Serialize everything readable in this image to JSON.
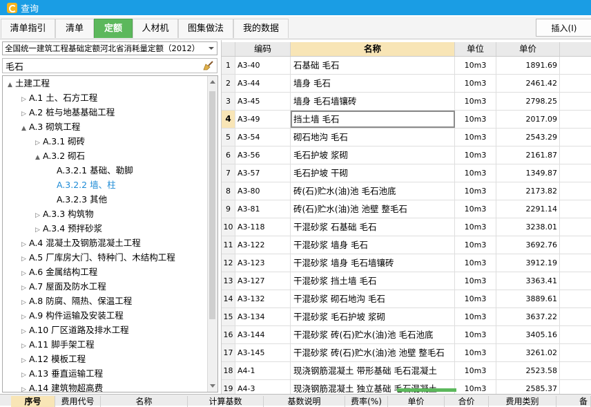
{
  "window": {
    "title": "查询"
  },
  "tabs": [
    {
      "label": "清单指引",
      "active": false
    },
    {
      "label": "清单",
      "active": false
    },
    {
      "label": "定额",
      "active": true
    },
    {
      "label": "人材机",
      "active": false
    },
    {
      "label": "图集做法",
      "active": false
    },
    {
      "label": "我的数据",
      "active": false
    }
  ],
  "insert_button": "插入(I)",
  "quota_select": {
    "value": "全国统一建筑工程基础定额河北省消耗量定额（2012）"
  },
  "search": {
    "value": "毛石",
    "icon": "broom-icon"
  },
  "tree": [
    {
      "label": "土建工程",
      "level": 0,
      "toggle": "▲"
    },
    {
      "label": "A.1 土、石方工程",
      "level": 1,
      "toggle": "▷"
    },
    {
      "label": "A.2 桩与地基基础工程",
      "level": 1,
      "toggle": "▷"
    },
    {
      "label": "A.3 砌筑工程",
      "level": 1,
      "toggle": "▲"
    },
    {
      "label": "A.3.1 砌砖",
      "level": 2,
      "toggle": "▷"
    },
    {
      "label": "A.3.2 砌石",
      "level": 2,
      "toggle": "▲"
    },
    {
      "label": "A.3.2.1 基础、勒脚",
      "level": 3,
      "toggle": ""
    },
    {
      "label": "A.3.2.2 墙、柱",
      "level": 3,
      "toggle": "",
      "selected": true
    },
    {
      "label": "A.3.2.3 其他",
      "level": 3,
      "toggle": ""
    },
    {
      "label": "A.3.3 构筑物",
      "level": 2,
      "toggle": "▷"
    },
    {
      "label": "A.3.4 预拌砂浆",
      "level": 2,
      "toggle": "▷"
    },
    {
      "label": "A.4 混凝土及钢筋混凝土工程",
      "level": 1,
      "toggle": "▷"
    },
    {
      "label": "A.5 厂库房大门、特种门、木结构工程",
      "level": 1,
      "toggle": "▷"
    },
    {
      "label": "A.6 金属结构工程",
      "level": 1,
      "toggle": "▷"
    },
    {
      "label": "A.7 屋面及防水工程",
      "level": 1,
      "toggle": "▷"
    },
    {
      "label": "A.8 防腐、隔热、保温工程",
      "level": 1,
      "toggle": "▷"
    },
    {
      "label": "A.9 构件运输及安装工程",
      "level": 1,
      "toggle": "▷"
    },
    {
      "label": "A.10 厂区道路及排水工程",
      "level": 1,
      "toggle": "▷"
    },
    {
      "label": "A.11 脚手架工程",
      "level": 1,
      "toggle": "▷"
    },
    {
      "label": "A.12 模板工程",
      "level": 1,
      "toggle": "▷"
    },
    {
      "label": "A.13 垂直运输工程",
      "level": 1,
      "toggle": "▷"
    },
    {
      "label": "A.14 建筑物超高费",
      "level": 1,
      "toggle": "▷"
    }
  ],
  "table": {
    "headers": [
      "编码",
      "名称",
      "单位",
      "单价"
    ],
    "rows": [
      {
        "idx": "1",
        "code": "A3-40",
        "name": "石基础 毛石",
        "unit": "10m3",
        "price": "1891.69"
      },
      {
        "idx": "2",
        "code": "A3-44",
        "name": "墙身 毛石",
        "unit": "10m3",
        "price": "2461.42"
      },
      {
        "idx": "3",
        "code": "A3-45",
        "name": "墙身 毛石墙镶砖",
        "unit": "10m3",
        "price": "2798.25"
      },
      {
        "idx": "4",
        "code": "A3-49",
        "name": "挡土墙 毛石",
        "unit": "10m3",
        "price": "2017.09",
        "active": true
      },
      {
        "idx": "5",
        "code": "A3-54",
        "name": "砌石地沟 毛石",
        "unit": "10m3",
        "price": "2543.29"
      },
      {
        "idx": "6",
        "code": "A3-56",
        "name": "毛石护坡 浆砌",
        "unit": "10m3",
        "price": "2161.87"
      },
      {
        "idx": "7",
        "code": "A3-57",
        "name": "毛石护坡 干砌",
        "unit": "10m3",
        "price": "1349.87"
      },
      {
        "idx": "8",
        "code": "A3-80",
        "name": "砖(石)贮水(油)池 毛石池底",
        "unit": "10m3",
        "price": "2173.82"
      },
      {
        "idx": "9",
        "code": "A3-81",
        "name": "砖(石)贮水(油)池 池壁 整毛石",
        "unit": "10m3",
        "price": "2291.14"
      },
      {
        "idx": "10",
        "code": "A3-118",
        "name": "干混砂浆 石基础 毛石",
        "unit": "10m3",
        "price": "3238.01"
      },
      {
        "idx": "11",
        "code": "A3-122",
        "name": "干混砂浆 墙身 毛石",
        "unit": "10m3",
        "price": "3692.76"
      },
      {
        "idx": "12",
        "code": "A3-123",
        "name": "干混砂浆 墙身 毛石墙镶砖",
        "unit": "10m3",
        "price": "3912.19"
      },
      {
        "idx": "13",
        "code": "A3-127",
        "name": "干混砂浆 挡土墙 毛石",
        "unit": "10m3",
        "price": "3363.41"
      },
      {
        "idx": "14",
        "code": "A3-132",
        "name": "干混砂浆 砌石地沟 毛石",
        "unit": "10m3",
        "price": "3889.61"
      },
      {
        "idx": "15",
        "code": "A3-134",
        "name": "干混砂浆 毛石护坡 浆砌",
        "unit": "10m3",
        "price": "3637.22"
      },
      {
        "idx": "16",
        "code": "A3-144",
        "name": "干混砂浆 砖(石)贮水(油)池 毛石池底",
        "unit": "10m3",
        "price": "3405.16"
      },
      {
        "idx": "17",
        "code": "A3-145",
        "name": "干混砂浆 砖(石)贮水(油)池 池壁 整毛石",
        "unit": "10m3",
        "price": "3261.02"
      },
      {
        "idx": "18",
        "code": "A4-1",
        "name": "现浇钢筋混凝土 带形基础 毛石混凝土",
        "unit": "10m3",
        "price": "2523.58"
      },
      {
        "idx": "19",
        "code": "A4-3",
        "name": "现浇钢筋混凝土 独立基础 毛石混凝土",
        "unit": "10m3",
        "price": "2585.37"
      }
    ]
  },
  "bottom_columns": [
    "序号",
    "费用代号",
    "名称",
    "计算基数",
    "基数说明",
    "费率(%)",
    "单价",
    "合价",
    "费用类别",
    "备"
  ]
}
